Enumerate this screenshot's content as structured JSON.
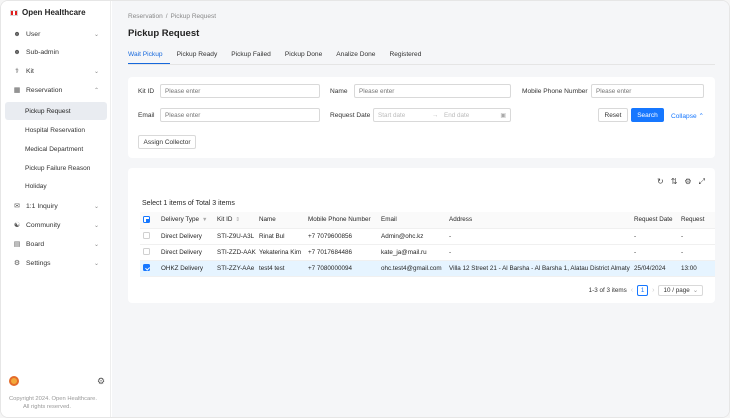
{
  "app": {
    "title": "Open Healthcare"
  },
  "sidebar": {
    "items": [
      {
        "label": "User",
        "icon": "user-icon",
        "chevron": "⌄"
      },
      {
        "label": "Sub-admin",
        "icon": "user-icon",
        "chevron": ""
      },
      {
        "label": "Kit",
        "icon": "kit-icon",
        "chevron": "⌄"
      },
      {
        "label": "Reservation",
        "icon": "calendar-icon",
        "chevron": "⌃"
      },
      {
        "label": "1:1 Inquiry",
        "icon": "chat-icon",
        "chevron": "⌄"
      },
      {
        "label": "Community",
        "icon": "community-icon",
        "chevron": "⌄"
      },
      {
        "label": "Board",
        "icon": "board-icon",
        "chevron": "⌄"
      },
      {
        "label": "Settings",
        "icon": "settings-icon",
        "chevron": "⌄"
      }
    ],
    "reservation_sub": [
      "Pickup Request",
      "Hospital Reservation",
      "Medical Department",
      "Pickup Failure Reason",
      "Holiday"
    ],
    "footer_line1": "Copyright 2024. Open Healthcare.",
    "footer_line2": "All rights reserved."
  },
  "breadcrumb": {
    "parent": "Reservation",
    "sep": "/",
    "current": "Pickup Request"
  },
  "page_title": "Pickup Request",
  "tabs": [
    "Wait Pickup",
    "Pickup Ready",
    "Pickup Failed",
    "Pickup Done",
    "Analize Done",
    "Registered"
  ],
  "filters": {
    "kit_id_label": "Kit ID",
    "name_label": "Name",
    "mobile_label": "Mobile Phone Number",
    "email_label": "Email",
    "request_date_label": "Request Date",
    "placeholder": "Please enter",
    "start_date": "Start date",
    "end_date": "End date",
    "reset": "Reset",
    "search": "Search",
    "collapse": "Collapse"
  },
  "assign_collector": "Assign Collector",
  "table": {
    "select_info": "Select 1  items of Total 3 items",
    "columns": [
      "Delivery Type",
      "Kit ID",
      "Name",
      "Mobile Phone Number",
      "Email",
      "Address",
      "Request Date",
      "Request"
    ],
    "rows": [
      {
        "delivery": "Direct Delivery",
        "kit": "STI-Z9U-A3L",
        "name": "Rinat Bul",
        "phone": "+7 7079600856",
        "email": "Admin@ohc.kz",
        "address": "-",
        "date": "-",
        "req": "-"
      },
      {
        "delivery": "Direct Delivery",
        "kit": "STI-ZZD-AAK",
        "name": "Yekaterina Kim",
        "phone": "+7 7017684486",
        "email": "kate_ja@mail.ru",
        "address": "-",
        "date": "-",
        "req": "-"
      },
      {
        "delivery": "OHKZ Delivery",
        "kit": "STI-ZZY-AAe",
        "name": "test4 test",
        "phone": "+7 7080000094",
        "email": "ohc.test4@gmail.com",
        "address": "Villa 12 Street 21 - Al Barsha - Al Barsha 1, Alatau District Almaty",
        "date": "25/04/2024",
        "req": "13:00"
      }
    ]
  },
  "pagination": {
    "summary": "1-3 of 3 items",
    "page": "1",
    "size": "10 / page"
  },
  "colors": {
    "primary": "#1677ff",
    "selected_row": "#e6f4ff",
    "sidebar_active": "#e9ecf1"
  }
}
